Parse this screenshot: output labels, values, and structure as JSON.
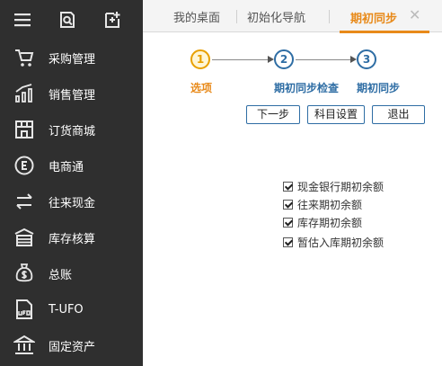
{
  "sidebar": {
    "top_icons": [
      "menu-icon",
      "search-doc-icon",
      "add-doc-icon"
    ],
    "items": [
      {
        "label": "采购管理",
        "icon": "cart-icon"
      },
      {
        "label": "销售管理",
        "icon": "chart-icon"
      },
      {
        "label": "订货商城",
        "icon": "store-icon"
      },
      {
        "label": "电商通",
        "icon": "ecommerce-icon"
      },
      {
        "label": "往来现金",
        "icon": "exchange-icon"
      },
      {
        "label": "库存核算",
        "icon": "warehouse-icon"
      },
      {
        "label": "总账",
        "icon": "ledger-icon"
      },
      {
        "label": "T-UFO",
        "icon": "ufo-report-icon"
      },
      {
        "label": "固定资产",
        "icon": "asset-icon"
      }
    ]
  },
  "tabs": [
    {
      "label": "我的桌面"
    },
    {
      "label": "初始化导航"
    },
    {
      "label": "期初同步",
      "active": true
    }
  ],
  "stepper": {
    "steps": [
      {
        "number": "1",
        "label": "选项",
        "active": true
      },
      {
        "number": "2",
        "label": "期初同步检查",
        "active": false
      },
      {
        "number": "3",
        "label": "期初同步",
        "active": false
      }
    ]
  },
  "buttons": {
    "next": "下一步",
    "subject_settings": "科目设置",
    "exit": "退出"
  },
  "options": [
    {
      "label": "现金银行期初余额",
      "checked": true
    },
    {
      "label": "往来期初余额",
      "checked": true
    },
    {
      "label": "库存期初余额",
      "checked": true
    },
    {
      "label": "暂估入库期初余额",
      "checked": true
    }
  ],
  "colors": {
    "sidebar_bg": "#2f2f2f",
    "accent_orange": "#e88a1a",
    "step_blue": "#2e6da4"
  }
}
